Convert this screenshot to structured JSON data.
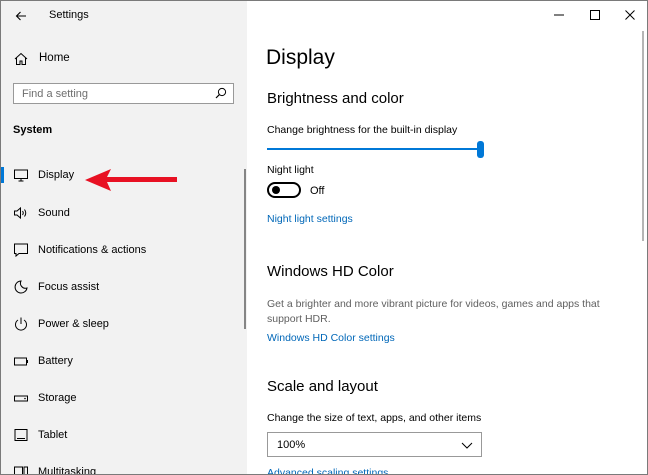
{
  "window": {
    "title": "Settings",
    "controls": [
      "minimize",
      "maximize",
      "close"
    ]
  },
  "sidebar": {
    "home_label": "Home",
    "search_placeholder": "Find a setting",
    "section_header": "System",
    "items": [
      {
        "label": "Display",
        "icon": "monitor-icon",
        "selected": true
      },
      {
        "label": "Sound",
        "icon": "speaker-icon"
      },
      {
        "label": "Notifications & actions",
        "icon": "notification-icon"
      },
      {
        "label": "Focus assist",
        "icon": "moon-icon"
      },
      {
        "label": "Power & sleep",
        "icon": "power-icon"
      },
      {
        "label": "Battery",
        "icon": "battery-icon"
      },
      {
        "label": "Storage",
        "icon": "storage-icon"
      },
      {
        "label": "Tablet",
        "icon": "tablet-icon"
      },
      {
        "label": "Multitasking",
        "icon": "multitasking-icon"
      }
    ]
  },
  "main": {
    "title": "Display",
    "brightness": {
      "heading": "Brightness and color",
      "slider_label": "Change brightness for the built-in display",
      "brightness_level": 1.0,
      "night_light_label": "Night light",
      "night_light_state": "Off",
      "night_light_settings_link": "Night light settings"
    },
    "hdr": {
      "heading": "Windows HD Color",
      "description": "Get a brighter and more vibrant picture for videos, games and apps that support HDR.",
      "settings_link": "Windows HD Color settings"
    },
    "scale": {
      "heading": "Scale and layout",
      "size_label": "Change the size of text, apps, and other items",
      "size_value": "100%",
      "advanced_link": "Advanced scaling settings"
    }
  },
  "colors": {
    "accent": "#0078d7",
    "link": "#0067b8",
    "sidebar_bg": "#f2f2f2",
    "annotation_arrow": "#e81123"
  }
}
